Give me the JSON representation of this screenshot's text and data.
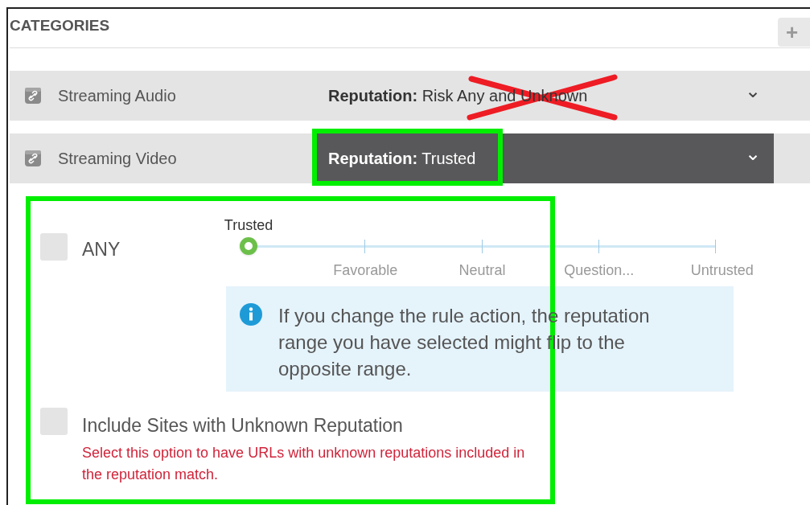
{
  "panel": {
    "title": "CATEGORIES",
    "add_button": "+"
  },
  "categories": [
    {
      "name": "Streaming Audio",
      "reputation_label": "Reputation:",
      "reputation_value": "Risk Any and Unknown",
      "expanded": false
    },
    {
      "name": "Streaming Video",
      "reputation_label": "Reputation:",
      "reputation_value": "Trusted",
      "expanded": true
    }
  ],
  "caret": "⌄",
  "any_checkbox": {
    "label": "ANY",
    "checked": false
  },
  "reputation_slider": {
    "value_label": "Trusted",
    "level": 0,
    "ticks": [
      "Favorable",
      "Neutral",
      "Question...",
      "Untrusted"
    ]
  },
  "info_note": {
    "text": "If you change the rule action, the reputation range you have selected might flip to the opposite range."
  },
  "unknown_checkbox": {
    "label": "Include Sites with Unknown Reputation",
    "checked": false,
    "help": "Select this option to have URLs with unknown reputations included in the reputation match."
  },
  "annotations": [
    {
      "kind": "cross",
      "color": "#ee1c24"
    },
    {
      "kind": "box",
      "color": "#00ee00"
    },
    {
      "kind": "box",
      "color": "#00ee00"
    }
  ]
}
